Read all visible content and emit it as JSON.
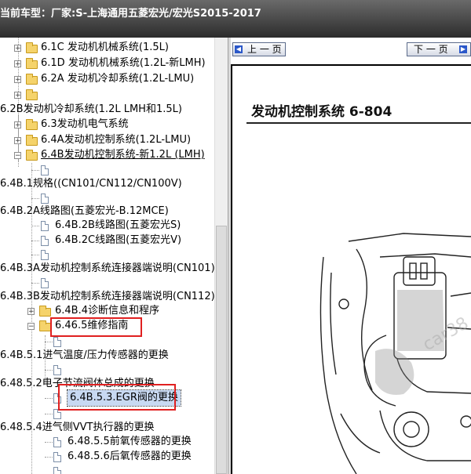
{
  "title": {
    "label": "当前车型：",
    "value": "厂家:S-上海通用五菱宏光/宏光S2015-2017"
  },
  "tree": {
    "items": [
      "6.1C 发动机机械系统(1.5L)",
      "6.1D 发动机机械系统(1.2L-新LMH)",
      "6.2A 发动机冷却系统(1.2L-LMU)",
      "",
      "6.2B发动机冷却系统(1.2L LMH和1.5L)",
      "6.3发动机电气系统",
      "6.4A发动机控制系统(1.2L-LMU)",
      "6.4B发动机控制系统-新1.2L (LMH)",
      "",
      "6.4B.1规格((CN101/CN112/CN100V)",
      "",
      "6.4B.2A线路图(五菱宏光-B.12MCE)",
      "6.4B.2B线路图(五菱宏光S)",
      "6.4B.2C线路图(五菱宏光V)",
      "",
      "6.4B.3A发动机控制系统连接器端说明(CN101)",
      "",
      "6.4B.3B发动机控制系统连接器端说明(CN112)",
      "6.4B.4诊断信息和程序",
      "6.46.5维修指南",
      "",
      "6.4B.5.1进气温度/压力传感器的更换",
      "",
      "6.48.5.2电子节流阀体总成的更换",
      "6.4B.5.3.EGR阀的更换",
      "",
      "6.48.5.4进气侧VVT执行器的更换",
      "6.48.5.5前氧传感器的更换",
      "6.48.5.6后氧传感器的更换"
    ]
  },
  "viewer": {
    "prev_label": "上 一 页",
    "next_label": "下 一 页",
    "page_title": "发动机控制系统  6-804",
    "watermark": "car38 CY2"
  },
  "colors": {
    "highlight_box": "#e02020",
    "selection": "#c8d9f2",
    "arrow_icon": "#2a57c9"
  }
}
